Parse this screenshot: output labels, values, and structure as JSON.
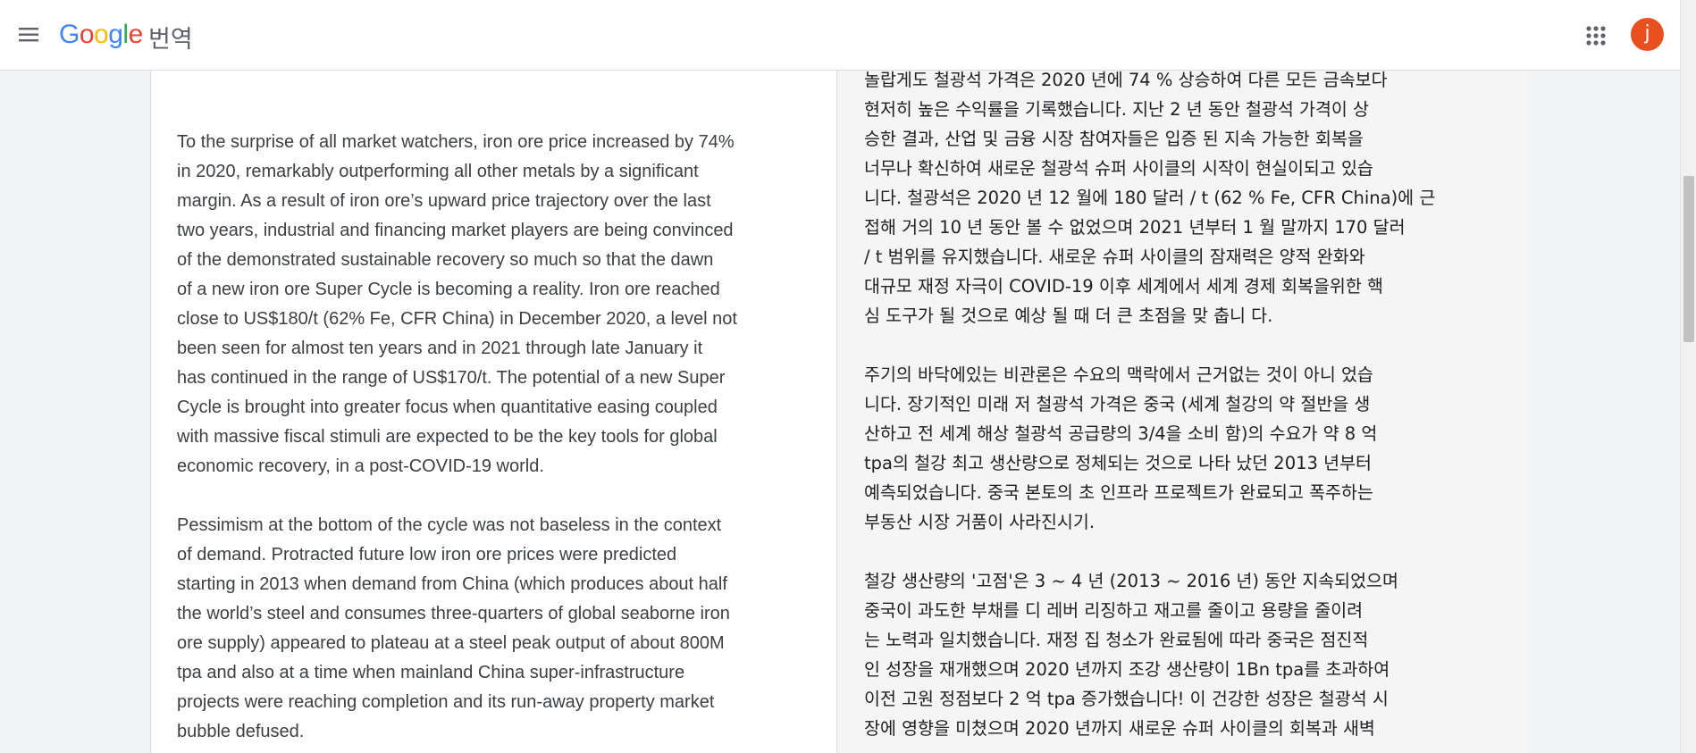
{
  "header": {
    "brand_letters": [
      {
        "char": "G",
        "color": "#4285F4"
      },
      {
        "char": "o",
        "color": "#EA4335"
      },
      {
        "char": "o",
        "color": "#FBBC05"
      },
      {
        "char": "g",
        "color": "#4285F4"
      },
      {
        "char": "l",
        "color": "#34A853"
      },
      {
        "char": "e",
        "color": "#EA4335"
      }
    ],
    "app_name": "번역",
    "menu_icon": "hamburger-menu-icon",
    "apps_icon": "apps-grid-icon",
    "avatar_letter": "j",
    "avatar_color": "#E8511F"
  },
  "source": {
    "paragraphs": [
      "To the surprise of all market watchers, iron ore price increased by 74%\nin 2020, remarkably outperforming all other metals by a significant\nmargin. As a result of iron ore’s upward price trajectory over the last\ntwo years, industrial and financing market players are being convinced\nof the demonstrated sustainable recovery so much so that the dawn\nof a new iron ore Super Cycle is becoming a reality. Iron ore reached\nclose to US$180/t (62% Fe, CFR China) in December 2020, a level not\nbeen seen for almost ten years and in 2021 through late January it\nhas continued in the range of US$170/t. The potential of a new Super\nCycle is brought into greater focus when quantitative easing coupled\nwith massive fiscal stimuli are expected to be the key tools for global\neconomic recovery, in a post-COVID-19 world.",
      "Pessimism at the bottom of the cycle was not baseless in the context\nof demand.  Protracted future low iron ore prices were predicted\nstarting in 2013 when demand from China (which produces about half\nthe world’s steel and consumes three-quarters of global seaborne iron\nore supply) appeared to plateau at a steel peak output of about 800M\ntpa and also at a time when mainland China super-infrastructure\nprojects were reaching completion and its run-away property market\nbubble defused."
    ]
  },
  "translation": {
    "paragraphs": [
      "놀랍게도 철광석 가격은 2020 년에 74 % 상승하여 다른 모든 금속보다\n현저히 높은 수익률을 기록했습니다. 지난 2 년 동안 철광석 가격이 상\n승한 결과, 산업 및 금융 시장 참여자들은 입증 된 지속 가능한 회복을\n너무나 확신하여 새로운 철광석 슈퍼 사이클의 시작이 현실이되고 있습\n니다. 철광석은 2020 년 12 월에 180 달러 / t (62 % Fe, CFR China)에 근\n접해 거의 10 년 동안 볼 수 없었으며 2021 년부터 1 월 말까지 170 달러\n/ t 범위를 유지했습니다. 새로운 슈퍼 사이클의 잠재력은 양적 완화와\n대규모 재정 자극이 COVID-19 이후 세계에서 세계 경제 회복을위한 핵\n심 도구가 될 것으로 예상 될 때 더 큰 초점을 맞 춥니 다.",
      "주기의 바닥에있는 비관론은 수요의 맥락에서 근거없는 것이 아니 었습\n니다. 장기적인 미래 저 철광석 가격은 중국 (세계 철강의 약 절반을 생\n산하고 전 세계 해상 철광석 공급량의 3/4을 소비 함)의 수요가 약 8 억\ntpa의 철강 최고 생산량으로 정체되는 것으로 나타 났던 2013 년부터\n예측되었습니다. 중국 본토의 초 인프라 프로젝트가 완료되고 폭주하는\n부동산 시장 거품이 사라진시기.",
      "철강 생산량의 '고점'은 3 ~ 4 년 (2013 ~ 2016 년) 동안 지속되었으며\n중국이 과도한 부채를 디 레버 리징하고 재고를 줄이고 용량을 줄이려\n는 노력과 일치했습니다. 재정 집 청소가 완료됨에 따라 중국은 점진적\n인 성장을 재개했으며 2020 년까지 조강 생산량이 1Bn tpa를 초과하여\n이전 고원 정점보다 2 억 tpa 증가했습니다! 이 건강한 성장은 철광석 시\n장에 영향을 미쳤으며 2020 년까지 새로운 슈퍼 사이클의 회복과 새벽"
    ]
  }
}
